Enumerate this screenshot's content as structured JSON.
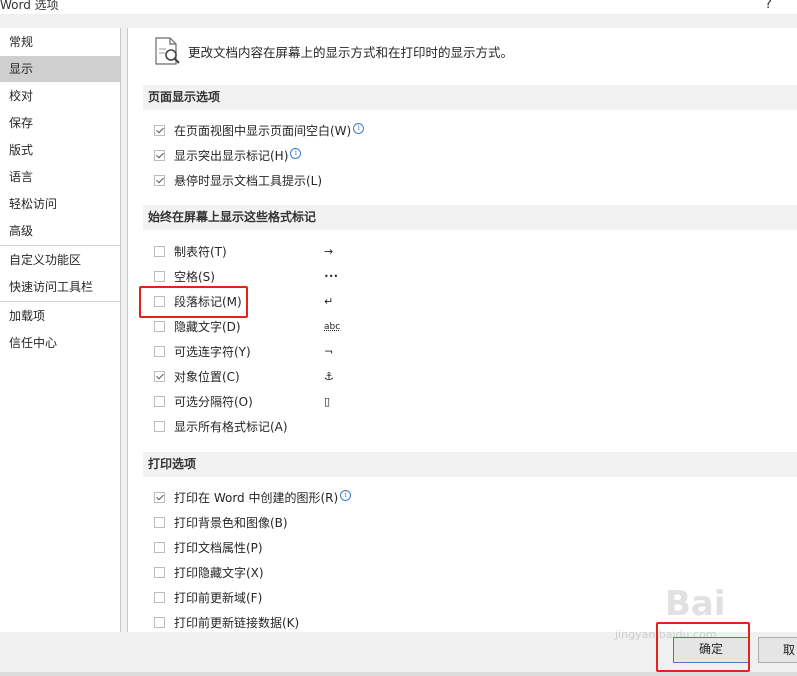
{
  "window": {
    "title": "Word 选项",
    "help": "?"
  },
  "sidebar": {
    "items": [
      {
        "label": "常规"
      },
      {
        "label": "显示",
        "selected": true
      },
      {
        "label": "校对"
      },
      {
        "label": "保存"
      },
      {
        "label": "版式"
      },
      {
        "label": "语言"
      },
      {
        "label": "轻松访问"
      },
      {
        "label": "高级"
      },
      {
        "label": "自定义功能区"
      },
      {
        "label": "快速访问工具栏"
      },
      {
        "label": "加载项"
      },
      {
        "label": "信任中心"
      }
    ]
  },
  "main": {
    "intro": "更改文档内容在屏幕上的显示方式和在打印时的显示方式。",
    "page_display": {
      "header": "页面显示选项",
      "options": [
        {
          "label": "在页面视图中显示页面间空白(W)",
          "checked": true,
          "info": true
        },
        {
          "label": "显示突出显示标记(H)",
          "checked": true,
          "info": true
        },
        {
          "label": "悬停时显示文档工具提示(L)",
          "checked": true
        }
      ]
    },
    "format_marks": {
      "header": "始终在屏幕上显示这些格式标记",
      "options": [
        {
          "label": "制表符(T)",
          "checked": false,
          "mark": "→"
        },
        {
          "label": "空格(S)",
          "checked": false,
          "mark": "•••"
        },
        {
          "label": "段落标记(M)",
          "checked": false,
          "mark": "↵"
        },
        {
          "label": "隐藏文字(D)",
          "checked": false,
          "mark": "abc"
        },
        {
          "label": "可选连字符(Y)",
          "checked": false,
          "mark": "¬"
        },
        {
          "label": "对象位置(C)",
          "checked": true,
          "mark": "⚓"
        },
        {
          "label": "可选分隔符(O)",
          "checked": false,
          "mark": "▯"
        },
        {
          "label": "显示所有格式标记(A)",
          "checked": false
        }
      ]
    },
    "print": {
      "header": "打印选项",
      "options": [
        {
          "label": "打印在 Word 中创建的图形(R)",
          "checked": true,
          "info": true
        },
        {
          "label": "打印背景色和图像(B)",
          "checked": false
        },
        {
          "label": "打印文档属性(P)",
          "checked": false
        },
        {
          "label": "打印隐藏文字(X)",
          "checked": false
        },
        {
          "label": "打印前更新域(F)",
          "checked": false
        },
        {
          "label": "打印前更新链接数据(K)",
          "checked": false
        }
      ]
    }
  },
  "footer": {
    "ok_label": "确定",
    "cancel_label": "取"
  },
  "watermark": {
    "text": "Bai",
    "sub": "jingyan.baidu.com"
  },
  "colors": {
    "highlight": "#e0241b",
    "selected_nav": "#cfcfcf",
    "ok_border": "#4a78c2"
  }
}
